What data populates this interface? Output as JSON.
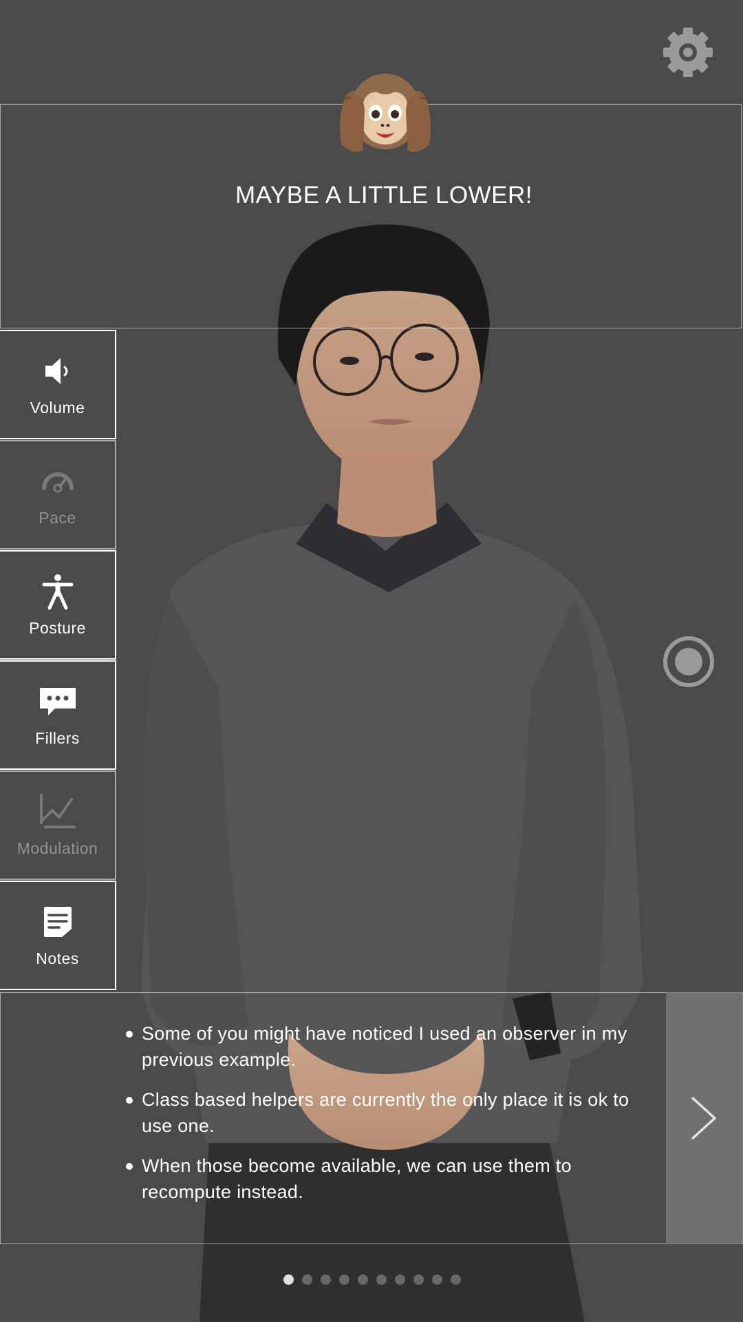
{
  "feedback": {
    "message": "MAYBE A LITTLE LOWER!",
    "emoji": "hear-no-evil-monkey"
  },
  "settings": {
    "icon": "gear-icon"
  },
  "sidebar": {
    "items": [
      {
        "label": "Volume",
        "icon": "speaker-icon",
        "active": true
      },
      {
        "label": "Pace",
        "icon": "speedometer-icon",
        "active": false
      },
      {
        "label": "Posture",
        "icon": "person-icon",
        "active": true
      },
      {
        "label": "Fillers",
        "icon": "speech-bubble-icon",
        "active": true
      },
      {
        "label": "Modulation",
        "icon": "line-chart-icon",
        "active": false
      },
      {
        "label": "Notes",
        "icon": "note-icon",
        "active": true
      }
    ]
  },
  "record": {
    "icon": "record-icon"
  },
  "notes": {
    "bullets": [
      "Some of you might have noticed I used an observer in my previous example.",
      "Class based helpers are currently the only place it is ok to use one.",
      "When those become available, we can use them to recompute instead."
    ],
    "next_icon": "chevron-right-icon"
  },
  "pagination": {
    "total": 10,
    "current": 1
  },
  "colors": {
    "background": "#4a4a4b",
    "text": "#ffffff",
    "icon_gray": "#9a9a9a"
  }
}
